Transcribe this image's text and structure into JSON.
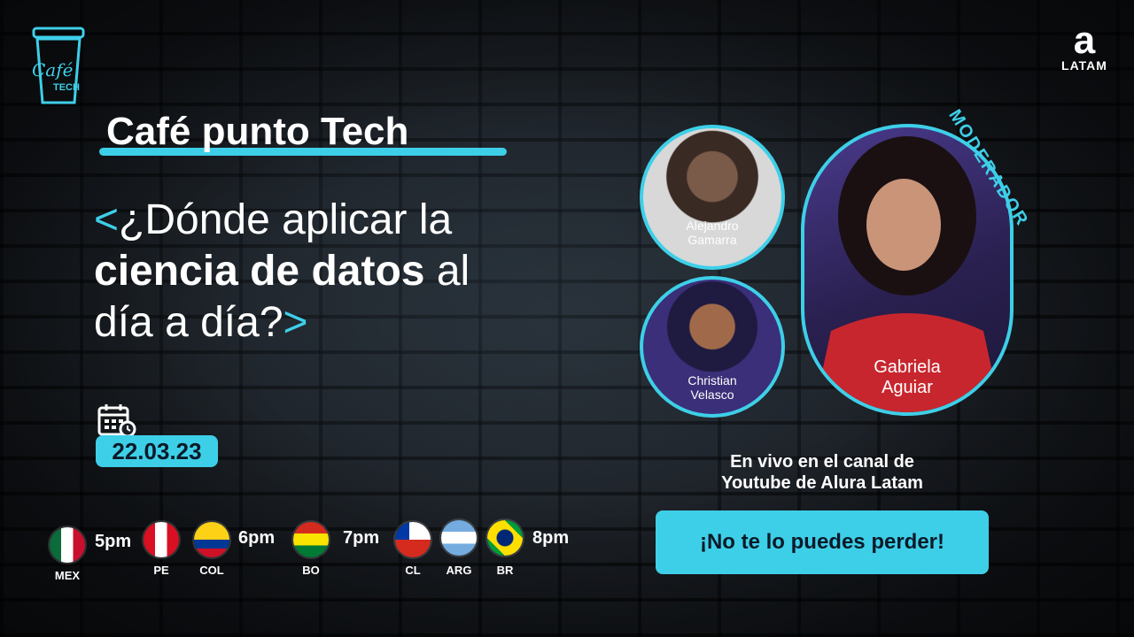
{
  "logo": {
    "cup_text_line1": "Café",
    "cup_text_line2": "TECH"
  },
  "brand": {
    "mark": "a",
    "label": "LATAM"
  },
  "event": {
    "title": "Café punto Tech",
    "headline_open": "<",
    "headline_line1": "¿Dónde aplicar la",
    "headline_bold": "ciencia de datos",
    "headline_after_bold": " al",
    "headline_line3": "día a día?",
    "headline_close": ">"
  },
  "date": "22.03.23",
  "schedule": [
    {
      "code": "MEX",
      "time": "5pm"
    },
    {
      "code": "PE",
      "time": ""
    },
    {
      "code": "COL",
      "time": "6pm"
    },
    {
      "code": "BO",
      "time": "7pm"
    },
    {
      "code": "CL",
      "time": ""
    },
    {
      "code": "ARG",
      "time": ""
    },
    {
      "code": "BR",
      "time": "8pm"
    }
  ],
  "speakers": [
    {
      "first": "Alejandro",
      "last": "Gamarra"
    },
    {
      "first": "Christian",
      "last": "Velasco"
    }
  ],
  "moderator": {
    "label": "MODERADOR",
    "first": "Gabriela",
    "last": "Aguiar"
  },
  "live": {
    "line1": "En vivo en el canal de",
    "line2": "Youtube de Alura Latam"
  },
  "cta": "¡No te lo puedes perder!",
  "colors": {
    "accent": "#3ecfe8",
    "text": "#ffffff",
    "background": "#1a1f26"
  }
}
